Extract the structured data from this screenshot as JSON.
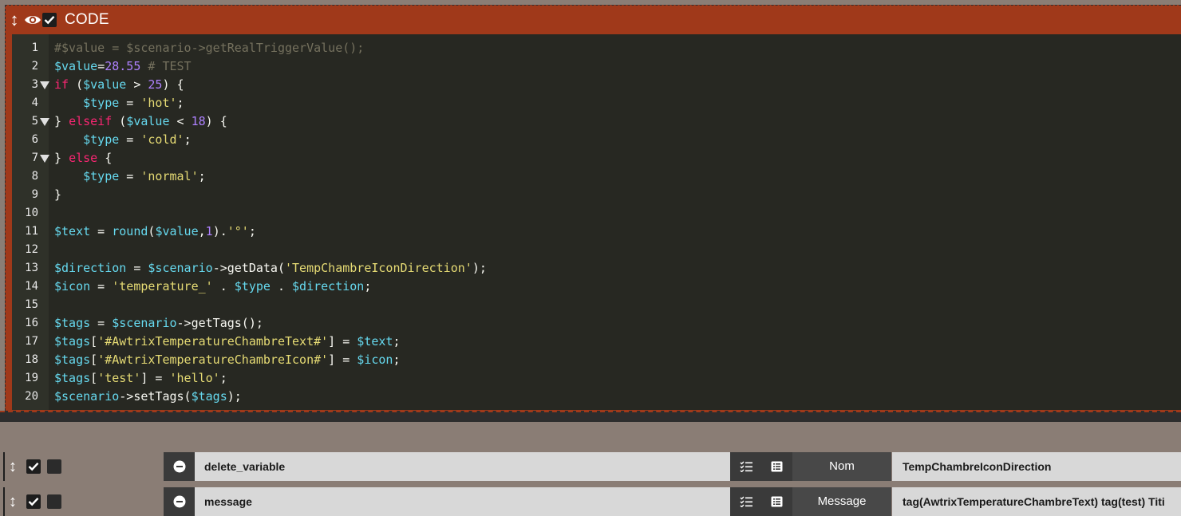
{
  "code_block": {
    "title": "CODE",
    "icons": {
      "drag": "drag-vertical-icon",
      "visibility": "eye-icon",
      "enabled": "checkbox-checked-icon"
    },
    "lines": [
      {
        "n": "1",
        "fold": false,
        "tokens": [
          [
            "cm",
            "#$value = $scenario->getRealTriggerValue();"
          ]
        ]
      },
      {
        "n": "2",
        "fold": false,
        "tokens": [
          [
            "var",
            "$value"
          ],
          [
            "op",
            "="
          ],
          [
            "num",
            "28.55"
          ],
          [
            "op",
            " "
          ],
          [
            "cm",
            "# TEST"
          ]
        ]
      },
      {
        "n": "3",
        "fold": true,
        "tokens": [
          [
            "kw",
            "if"
          ],
          [
            "op",
            " ("
          ],
          [
            "var",
            "$value"
          ],
          [
            "op",
            " > "
          ],
          [
            "num",
            "25"
          ],
          [
            "op",
            ") {"
          ]
        ]
      },
      {
        "n": "4",
        "fold": false,
        "tokens": [
          [
            "op",
            "    "
          ],
          [
            "var",
            "$type"
          ],
          [
            "op",
            " = "
          ],
          [
            "str",
            "'hot'"
          ],
          [
            "op",
            ";"
          ]
        ]
      },
      {
        "n": "5",
        "fold": true,
        "tokens": [
          [
            "op",
            "} "
          ],
          [
            "kw",
            "elseif"
          ],
          [
            "op",
            " ("
          ],
          [
            "var",
            "$value"
          ],
          [
            "op",
            " < "
          ],
          [
            "num",
            "18"
          ],
          [
            "op",
            ") {"
          ]
        ]
      },
      {
        "n": "6",
        "fold": false,
        "tokens": [
          [
            "op",
            "    "
          ],
          [
            "var",
            "$type"
          ],
          [
            "op",
            " = "
          ],
          [
            "str",
            "'cold'"
          ],
          [
            "op",
            ";"
          ]
        ]
      },
      {
        "n": "7",
        "fold": true,
        "tokens": [
          [
            "op",
            "} "
          ],
          [
            "kw",
            "else"
          ],
          [
            "op",
            " {"
          ]
        ]
      },
      {
        "n": "8",
        "fold": false,
        "tokens": [
          [
            "op",
            "    "
          ],
          [
            "var",
            "$type"
          ],
          [
            "op",
            " = "
          ],
          [
            "str",
            "'normal'"
          ],
          [
            "op",
            ";"
          ]
        ]
      },
      {
        "n": "9",
        "fold": false,
        "tokens": [
          [
            "op",
            "}"
          ]
        ]
      },
      {
        "n": "10",
        "fold": false,
        "tokens": []
      },
      {
        "n": "11",
        "fold": false,
        "tokens": [
          [
            "var",
            "$text"
          ],
          [
            "op",
            " = "
          ],
          [
            "fn",
            "round"
          ],
          [
            "op",
            "("
          ],
          [
            "var",
            "$value"
          ],
          [
            "op",
            ","
          ],
          [
            "num",
            "1"
          ],
          [
            "op",
            ")."
          ],
          [
            "str",
            "'°'"
          ],
          [
            "op",
            ";"
          ]
        ]
      },
      {
        "n": "12",
        "fold": false,
        "tokens": []
      },
      {
        "n": "13",
        "fold": false,
        "tokens": [
          [
            "var",
            "$direction"
          ],
          [
            "op",
            " = "
          ],
          [
            "var",
            "$scenario"
          ],
          [
            "op",
            "->getData("
          ],
          [
            "str",
            "'TempChambreIconDirection'"
          ],
          [
            "op",
            ");"
          ]
        ]
      },
      {
        "n": "14",
        "fold": false,
        "tokens": [
          [
            "var",
            "$icon"
          ],
          [
            "op",
            " = "
          ],
          [
            "str",
            "'temperature_'"
          ],
          [
            "op",
            " . "
          ],
          [
            "var",
            "$type"
          ],
          [
            "op",
            " . "
          ],
          [
            "var",
            "$direction"
          ],
          [
            "op",
            ";"
          ]
        ]
      },
      {
        "n": "15",
        "fold": false,
        "tokens": []
      },
      {
        "n": "16",
        "fold": false,
        "tokens": [
          [
            "var",
            "$tags"
          ],
          [
            "op",
            " = "
          ],
          [
            "var",
            "$scenario"
          ],
          [
            "op",
            "->getTags();"
          ]
        ]
      },
      {
        "n": "17",
        "fold": false,
        "tokens": [
          [
            "var",
            "$tags"
          ],
          [
            "op",
            "["
          ],
          [
            "str",
            "'#AwtrixTemperatureChambreText#'"
          ],
          [
            "op",
            "] = "
          ],
          [
            "var",
            "$text"
          ],
          [
            "op",
            ";"
          ]
        ]
      },
      {
        "n": "18",
        "fold": false,
        "tokens": [
          [
            "var",
            "$tags"
          ],
          [
            "op",
            "["
          ],
          [
            "str",
            "'#AwtrixTemperatureChambreIcon#'"
          ],
          [
            "op",
            "] = "
          ],
          [
            "var",
            "$icon"
          ],
          [
            "op",
            ";"
          ]
        ]
      },
      {
        "n": "19",
        "fold": false,
        "tokens": [
          [
            "var",
            "$tags"
          ],
          [
            "op",
            "["
          ],
          [
            "str",
            "'test'"
          ],
          [
            "op",
            "] = "
          ],
          [
            "str",
            "'hello'"
          ],
          [
            "op",
            ";"
          ]
        ]
      },
      {
        "n": "20",
        "fold": false,
        "tokens": [
          [
            "var",
            "$scenario"
          ],
          [
            "op",
            "->setTags("
          ],
          [
            "var",
            "$tags"
          ],
          [
            "op",
            ");"
          ]
        ]
      }
    ]
  },
  "actions": [
    {
      "command": "delete_variable",
      "param_label": "Nom",
      "param_value": "TempChambreIconDirection"
    },
    {
      "command": "message",
      "param_label": "Message",
      "param_value": "tag(AwtrixTemperatureChambreText) tag(test) Titi"
    }
  ],
  "action_icons": {
    "drag": "drag-vertical-icon",
    "enabled": "checkbox-checked-icon",
    "remove": "minus-circle-icon",
    "options": "list-check-icon",
    "log": "list-box-icon"
  },
  "colors": {
    "header": "#a0391a",
    "editor_bg": "#272822",
    "page_bg": "#8a7d75"
  }
}
